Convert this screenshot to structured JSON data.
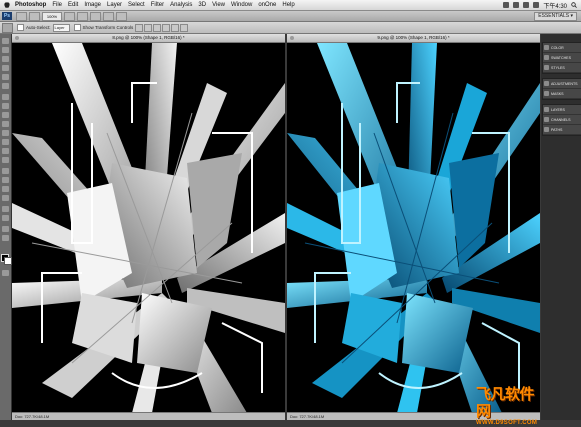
{
  "menubar": {
    "items": [
      "Photoshop",
      "File",
      "Edit",
      "Image",
      "Layer",
      "Select",
      "Filter",
      "Analysis",
      "3D",
      "View",
      "Window",
      "onOne",
      "Help"
    ],
    "clock": "下午4:30"
  },
  "appbar": {
    "zoom": "100%",
    "workspace": "ESSENTIALS ▾"
  },
  "options": {
    "auto_select_label": "Auto-Select:",
    "auto_select_value": "Layer",
    "transform_label": "Show Transform Controls"
  },
  "documents": [
    {
      "tab_title": "8.png @ 100% (Shape 1, RGB/16) *",
      "status": "Doc: 727.7K/48.1M",
      "palette": "white"
    },
    {
      "tab_title": "9.png @ 100% (Shape 1, RGB/16) *",
      "status": "Doc: 727.7K/48.1M",
      "palette": "cyan"
    }
  ],
  "panels": {
    "group1": [
      "COLOR",
      "SWATCHES",
      "STYLES"
    ],
    "group2": [
      "ADJUSTMENTS",
      "MASKS"
    ],
    "group3": [
      "LAYERS",
      "CHANNELS",
      "PATHS"
    ]
  },
  "watermark": {
    "title": "飞凡软件网",
    "url": "WWW.D9SOFT.COM"
  },
  "colors": {
    "accent_cyan": "#1aa6d8",
    "watermark_orange": "#ff8a00"
  }
}
